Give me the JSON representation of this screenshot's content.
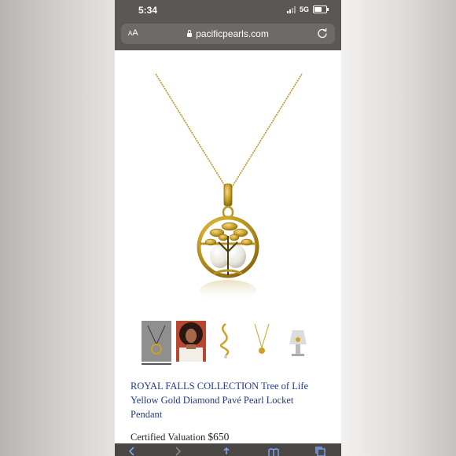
{
  "status_bar": {
    "time": "5:34",
    "network": "5G"
  },
  "browser": {
    "text_size_label": "AA",
    "url": "pacificpearls.com"
  },
  "product": {
    "title": "ROYAL FALLS COLLECTION Tree of Life Yellow Gold Diamond Pavé Pearl Locket Pendant",
    "valuation_label": "Certified Valuation",
    "valuation_amount": "$650",
    "selected_thumbnail": 1,
    "thumbnail_count": 5
  },
  "colors": {
    "title_link": "#1f3a8a",
    "gold": "#c9a227",
    "chrome": "#5b5754"
  },
  "icons": [
    "lock-icon",
    "reload-icon",
    "back-icon",
    "forward-icon",
    "share-icon",
    "bookmarks-icon",
    "tabs-icon"
  ]
}
